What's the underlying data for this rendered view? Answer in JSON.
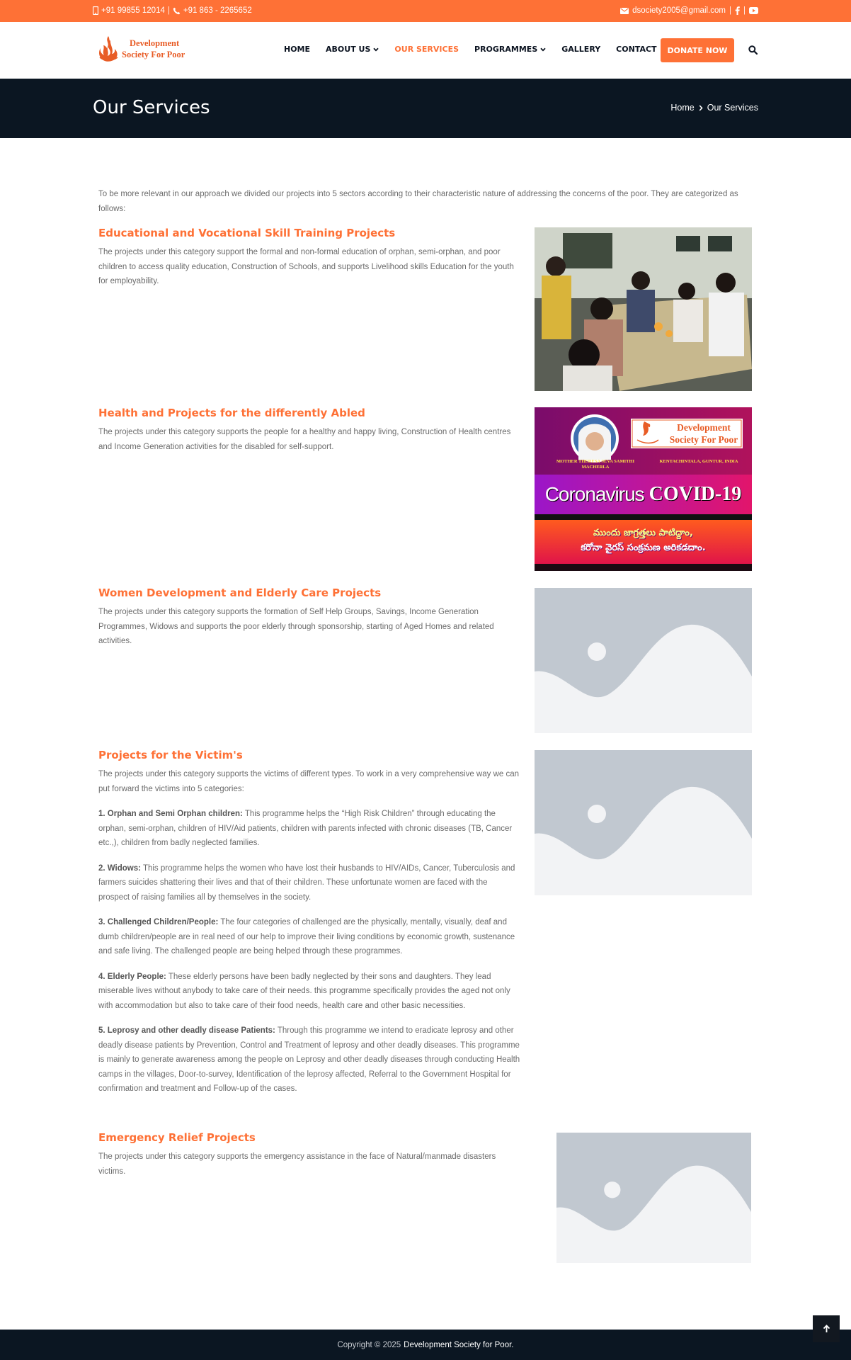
{
  "topbar": {
    "phone_mobile": "+91 99855 12014",
    "separator": "|",
    "phone_landline": "+91 863 - 2265652",
    "email": "dsociety2005@gmail.com"
  },
  "logo": {
    "line1": "Development",
    "line2": "Society For Poor"
  },
  "nav": {
    "items": [
      "HOME",
      "ABOUT US",
      "OUR SERVICES",
      "PROGRAMMES",
      "GALLERY",
      "CONTACT"
    ],
    "donate": "DONATE NOW"
  },
  "banner": {
    "title": "Our Services",
    "breadcrumb_home": "Home",
    "breadcrumb_current": "Our Services"
  },
  "intro": "To be more relevant in our approach we divided our projects into 5 sectors according to their characteristic nature of addressing the concerns of the poor. They are categorized as follows:",
  "sections": [
    {
      "title": "Educational and Vocational Skill Training Projects",
      "text": "The projects under this category support the formal and non-formal education of orphan, semi-orphan, and poor children to access quality education, Construction of Schools, and supports Livelihood skills Education for the youth for employability."
    },
    {
      "title": "Health and Projects for the differently Abled",
      "text": "The projects under this category supports the people for a healthy and happy living, Construction of Health centres and Income Generation activities for the disabled for self-support."
    },
    {
      "title": "Women Development and Elderly Care Projects",
      "text": "The projects under this category supports the formation of Self Help Groups, Savings, Income Generation Programmes, Widows and supports the poor elderly through sponsorship, starting of Aged Homes and related activities."
    },
    {
      "title": "Projects for the Victim's",
      "text": "The projects under this category supports the victims of different types. To work in a very comprehensive way we can put forward the victims into 5 categories:",
      "items": [
        {
          "label": "1. Orphan and Semi Orphan children:",
          "text": " This programme helps the “High Risk Children” through educating the orphan, semi-orphan, children of HIV/Aid patients, children with parents infected with chronic diseases (TB, Cancer etc.,), children from badly neglected families."
        },
        {
          "label": "2. Widows:",
          "text": " This programme helps the women who have lost their husbands to HIV/AIDs, Cancer, Tuberculosis and farmers suicides shattering their lives and that of their children. These unfortunate women are faced with the prospect of raising families all by themselves in the society."
        },
        {
          "label": "3. Challenged Children/People:",
          "text": " The four categories of challenged are the physically, mentally, visually, deaf and dumb children/people are in real need of our help to improve their living conditions by economic growth, sustenance and safe living. The challenged people are being helped through these programmes."
        },
        {
          "label": "4. Elderly People:",
          "text": " These elderly persons have been badly neglected by their sons and daughters. They lead miserable lives without anybody to take care of their needs. this programme specifically provides the aged not only with accommodation but also to take care of their food needs, health care and other basic necessities."
        },
        {
          "label": "5. Leprosy and other deadly disease Patients:",
          "text": " Through this programme we intend to eradicate leprosy and other deadly disease patients by Prevention, Control and Treatment of leprosy and other deadly diseases. This programme is mainly to generate awareness among the people on Leprosy and other deadly diseases through conducting Health camps in the villages, Door-to-survey, Identification of the leprosy affected, Referral to the Government Hospital for confirmation and treatment and Follow-up of the cases."
        }
      ]
    },
    {
      "title": "Emergency Relief Projects",
      "text": "The projects under this category supports the emergency assistance in the face of Natural/manmade disasters victims."
    }
  ],
  "covid_poster": {
    "brand_line1": "Development",
    "brand_line2": "Society For Poor",
    "org_left": "MOTHER THERESA SEVA SAMITHI MACHERLA",
    "org_right": "KENTACHINTALA, GUNTUR, INDIA",
    "headline_a": "Coronavirus",
    "headline_b": "COVID-19",
    "telugu_line1": "ముందు జాగ్రత్తలు పాటిద్దాం,",
    "telugu_line2": "కరోనా వైరస్ సంక్రమణ అరికడదాం."
  },
  "footer": {
    "copyright": "Copyright © 2025",
    "brand": "Development Society for Poor."
  },
  "colors": {
    "accent": "#fe7136",
    "dark": "#0b1622",
    "text": "#6b6b6b"
  }
}
